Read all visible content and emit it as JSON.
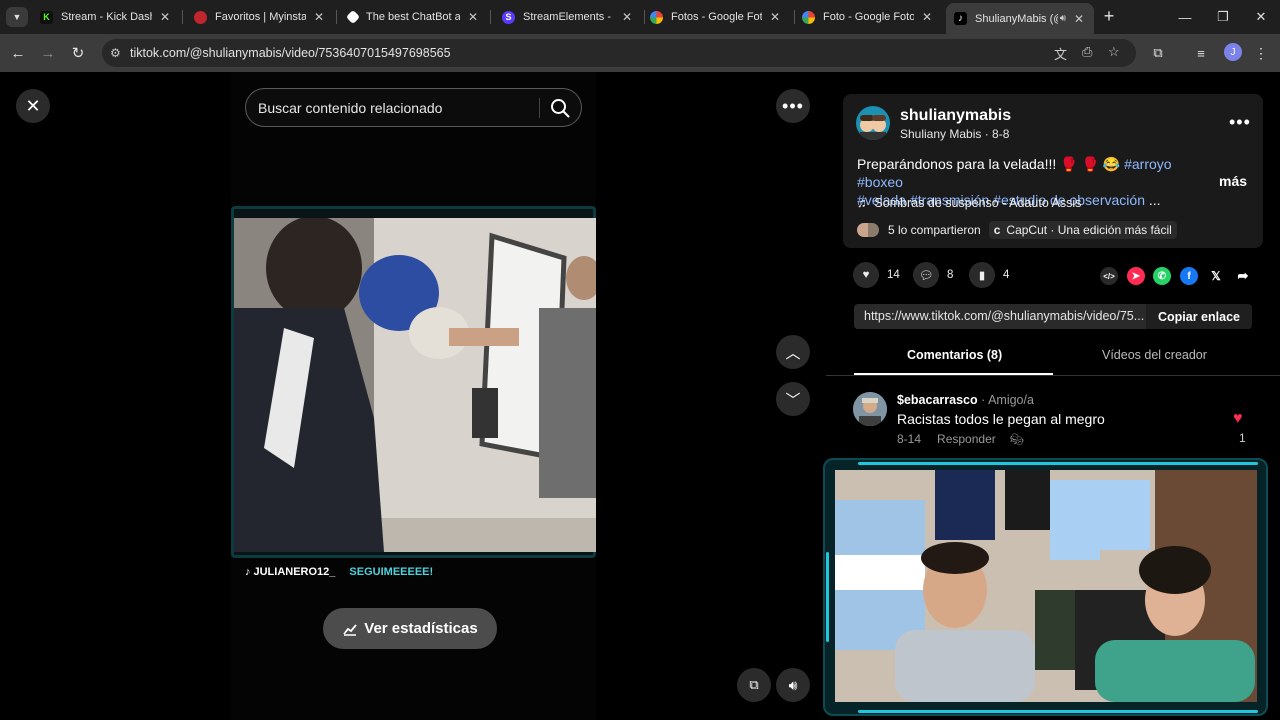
{
  "browser": {
    "tabs": [
      {
        "title": "Stream - Kick Dashbo",
        "favicon": "kick-icon",
        "color": "#53fc18"
      },
      {
        "title": "Favoritos | Myinstant",
        "favicon": "myinstants-icon",
        "color": "#c0262d"
      },
      {
        "title": "The best ChatBot anc",
        "favicon": "chatbot-icon",
        "color": "#ffffff"
      },
      {
        "title": "StreamElements - Su",
        "favicon": "streamelements-icon",
        "color": "#5b3bff"
      },
      {
        "title": "Fotos - Google Fotos",
        "favicon": "google-photos-icon",
        "color": "#fbbc04"
      },
      {
        "title": "Foto - Google Fotos",
        "favicon": "google-photos-icon",
        "color": "#fbbc04"
      },
      {
        "title": "ShulianyMabis (@",
        "favicon": "tiktok-icon",
        "color": "#ffffff"
      }
    ],
    "url": "tiktok.com/@shulianymabis/video/7536407015497698565",
    "profile_initial": "J"
  },
  "search": {
    "placeholder": "Buscar contenido relacionado"
  },
  "video": {
    "overlay_handle": "JULIANERO12_",
    "overlay_text": "SEGUIMEEEEE!",
    "stats_label": "Ver estadísticas"
  },
  "post": {
    "username": "shulianymabis",
    "display_name": "Shuliany Mabis",
    "date": "8-8",
    "description_text": "Preparándonos para la velada!!! 🥊 🥊 😂 ",
    "hashtags_line1": [
      "#arroyo",
      "#boxeo"
    ],
    "hashtags_line2": [
      "#velada",
      "#transmisión",
      "#estudio de observación"
    ],
    "ellipsis": "...",
    "more": "más",
    "music": "Sombras de suspenso - Adauto Assis",
    "shared_by": "5 lo compartieron",
    "capcut": "CapCut · Una edición más fácil",
    "likes": "14",
    "comments": "8",
    "saves": "4",
    "link": "https://www.tiktok.com/@shulianymabis/video/75...",
    "copy_link": "Copiar enlace"
  },
  "tabs": {
    "comments": "Comentarios (8)",
    "creator_videos": "Vídeos del creador"
  },
  "comment": {
    "author": "$ebacarrasco",
    "relation": "Amigo/a",
    "text": "Racistas todos le pegan al megro",
    "date": "8-14",
    "reply": "Responder",
    "likes": "1"
  },
  "colors": {
    "accent_pink": "#fe2c55",
    "hashtag": "#8fb9ff",
    "frame_glow": "#21c7dc"
  }
}
